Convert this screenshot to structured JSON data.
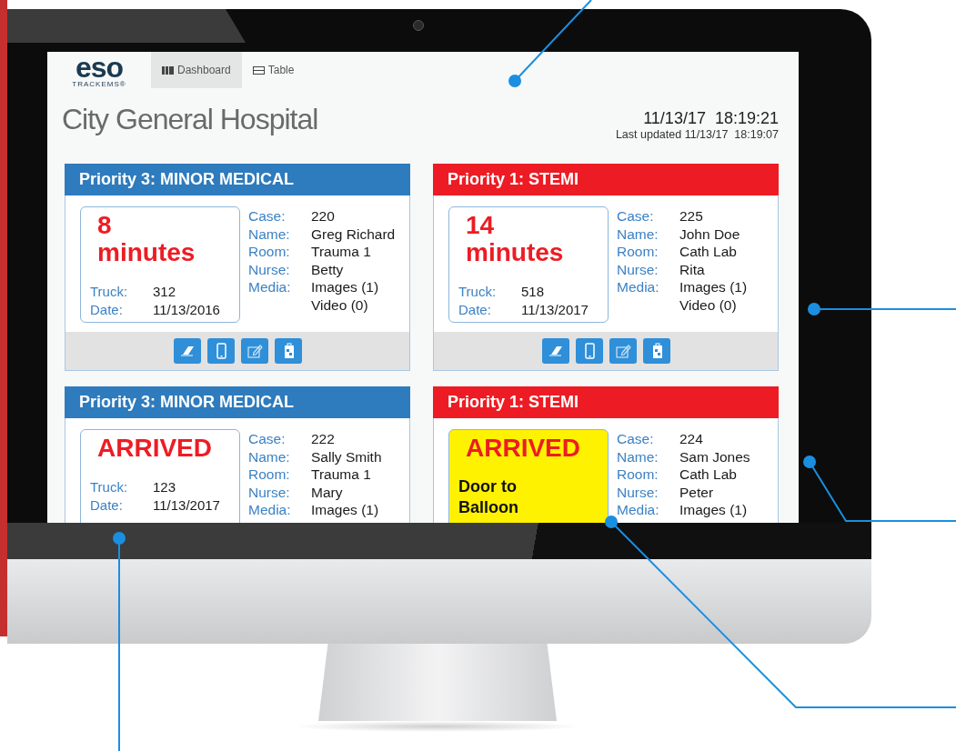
{
  "logo": {
    "name": "eso",
    "tagline": "TRACKEMS®"
  },
  "tabs": [
    {
      "label": "Dashboard",
      "kind": "dashboard",
      "selected": true
    },
    {
      "label": "Table",
      "kind": "table",
      "selected": false
    }
  ],
  "title": "City General Hospital",
  "clock": "11/13/17  18:19:21",
  "last_updated": "Last updated 11/13/17  18:19:07",
  "cards": [
    {
      "header": "Priority 3: MINOR MEDICAL",
      "color": "#2e7bbd",
      "status": "8 minutes",
      "highlighted": false,
      "info": [
        {
          "label": "Truck:",
          "value": "312"
        },
        {
          "label": "Date:",
          "value": "11/13/2016"
        }
      ],
      "details": [
        {
          "label": "Case:",
          "values": [
            "220"
          ]
        },
        {
          "label": "Name:",
          "values": [
            "Greg Richard"
          ]
        },
        {
          "label": "Room:",
          "values": [
            "Trauma 1"
          ]
        },
        {
          "label": "Nurse:",
          "values": [
            "Betty"
          ]
        },
        {
          "label": "Media:",
          "values": [
            "Images (1)",
            "Video (0)"
          ]
        }
      ],
      "actions": [
        {
          "kind": "eraser"
        },
        {
          "kind": "phone"
        },
        {
          "kind": "edit"
        },
        {
          "kind": "clipboard"
        }
      ]
    },
    {
      "header": "Priority 1: STEMI",
      "color": "#ed1c24",
      "status": "14 minutes",
      "highlighted": false,
      "info": [
        {
          "label": "Truck:",
          "value": "518"
        },
        {
          "label": "Date:",
          "value": "11/13/2017"
        }
      ],
      "details": [
        {
          "label": "Case:",
          "values": [
            "225"
          ]
        },
        {
          "label": "Name:",
          "values": [
            "John Doe"
          ]
        },
        {
          "label": "Room:",
          "values": [
            "Cath Lab"
          ]
        },
        {
          "label": "Nurse:",
          "values": [
            "Rita"
          ]
        },
        {
          "label": "Media:",
          "values": [
            "Images (1)",
            "Video (0)"
          ]
        }
      ],
      "actions": [
        {
          "kind": "eraser"
        },
        {
          "kind": "phone"
        },
        {
          "kind": "edit"
        },
        {
          "kind": "clipboard"
        }
      ]
    },
    {
      "header": "Priority 3: MINOR MEDICAL",
      "color": "#2e7bbd",
      "status": "ARRIVED",
      "highlighted": false,
      "info": [
        {
          "label": "Truck:",
          "value": "123"
        },
        {
          "label": "Date:",
          "value": "11/13/2017"
        }
      ],
      "details": [
        {
          "label": "Case:",
          "values": [
            "222"
          ]
        },
        {
          "label": "Name:",
          "values": [
            "Sally Smith"
          ]
        },
        {
          "label": "Room:",
          "values": [
            "Trauma 1"
          ]
        },
        {
          "label": "Nurse:",
          "values": [
            "Mary"
          ]
        },
        {
          "label": "Media:",
          "values": [
            "Images (1)"
          ]
        }
      ]
    },
    {
      "header": "Priority 1: STEMI",
      "color": "#ed1c24",
      "status": "ARRIVED",
      "highlighted": true,
      "note": "Door to Balloon",
      "details": [
        {
          "label": "Case:",
          "values": [
            "224"
          ]
        },
        {
          "label": "Name:",
          "values": [
            "Sam Jones"
          ]
        },
        {
          "label": "Room:",
          "values": [
            "Cath Lab"
          ]
        },
        {
          "label": "Nurse:",
          "values": [
            "Peter"
          ]
        },
        {
          "label": "Media:",
          "values": [
            "Images (1)"
          ]
        }
      ]
    }
  ]
}
